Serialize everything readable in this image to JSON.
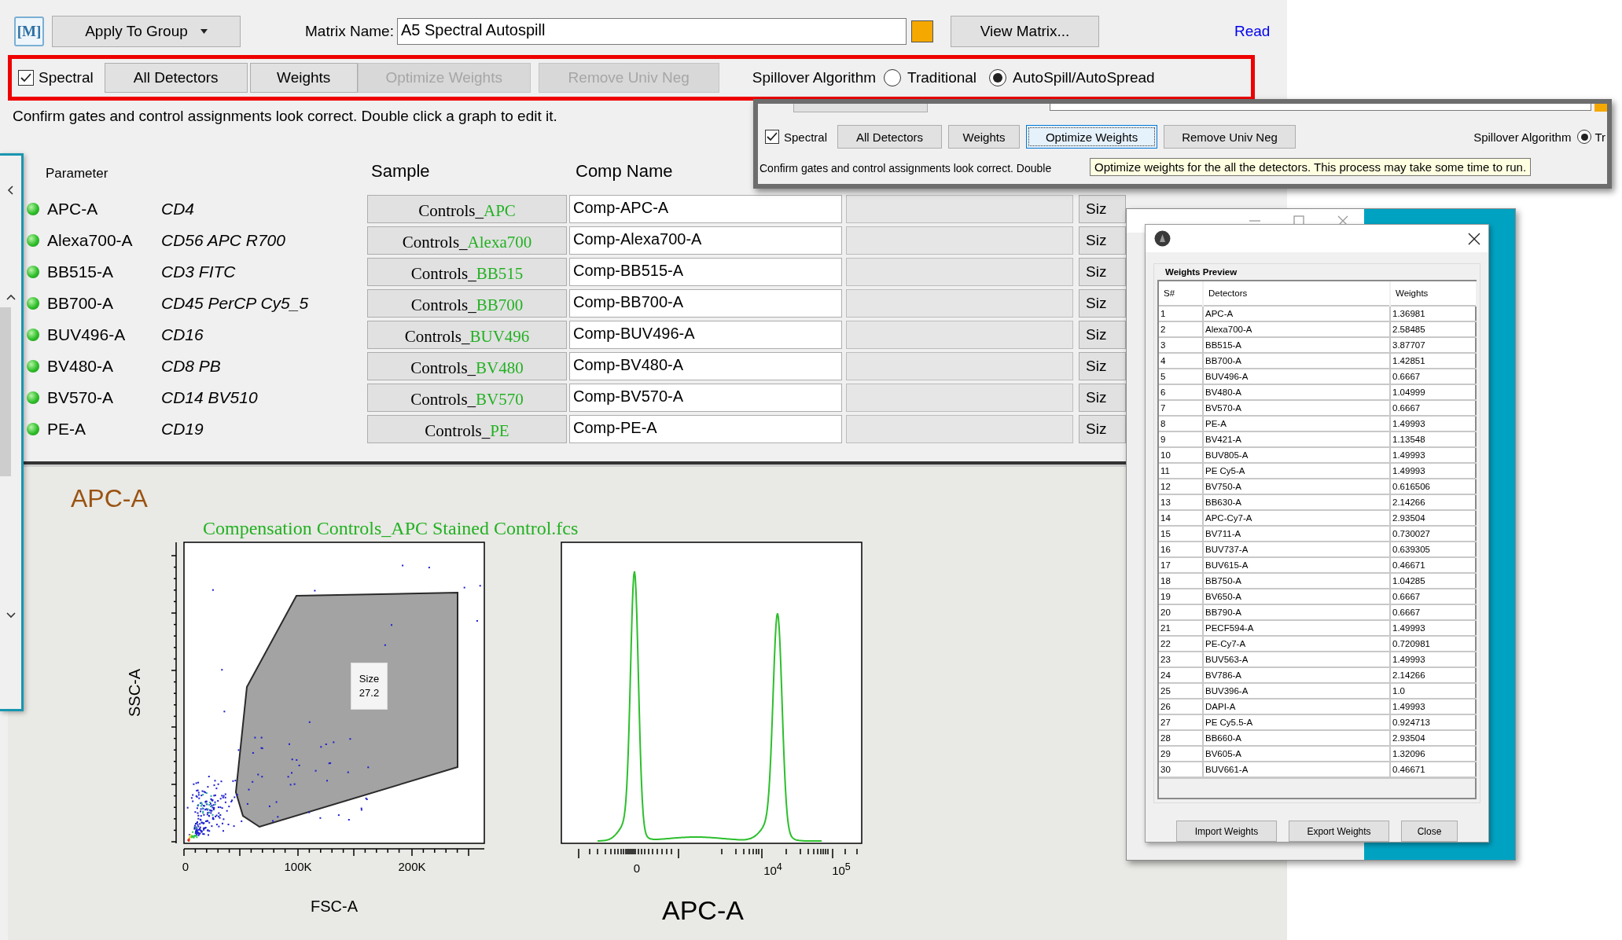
{
  "toolbar": {
    "logo": "[M]",
    "apply_button": "Apply To Group",
    "matrix_label": "Matrix Name:",
    "matrix_name": "A5 Spectral Autospill",
    "view_button": "View Matrix...",
    "status_link": "Read"
  },
  "options_bar": {
    "spectral": {
      "label": "Spectral",
      "checked": true
    },
    "buttons": [
      {
        "label": "All Detectors",
        "disabled": false
      },
      {
        "label": "Weights",
        "disabled": false
      },
      {
        "label": "Optimize Weights",
        "disabled": true
      },
      {
        "label": "Remove Univ Neg",
        "disabled": true
      }
    ],
    "algorithm_label": "Spillover Algorithm",
    "algorithms": [
      {
        "label": "Traditional",
        "selected": false
      },
      {
        "label": "AutoSpill/AutoSpread",
        "selected": true
      }
    ]
  },
  "message": "Confirm gates and control assignments look correct. Double click a graph to edit it.",
  "table": {
    "columns": [
      "Parameter",
      "Sample",
      "Comp Name"
    ],
    "rows": [
      {
        "parameter": "APC-A",
        "marker": "CD4",
        "sample_prefix": "Controls_",
        "sample_suffix": "APC",
        "comp_name": "Comp-APC-A",
        "size_button": "Siz"
      },
      {
        "parameter": "Alexa700-A",
        "marker": "CD56 APC R700",
        "sample_prefix": "Controls_",
        "sample_suffix": "Alexa700",
        "comp_name": "Comp-Alexa700-A",
        "size_button": "Siz"
      },
      {
        "parameter": "BB515-A",
        "marker": "CD3 FITC",
        "sample_prefix": "Controls_",
        "sample_suffix": "BB515",
        "comp_name": "Comp-BB515-A",
        "size_button": "Siz"
      },
      {
        "parameter": "BB700-A",
        "marker": "CD45 PerCP Cy5_5",
        "sample_prefix": "Controls_",
        "sample_suffix": "BB700",
        "comp_name": "Comp-BB700-A",
        "size_button": "Siz"
      },
      {
        "parameter": "BUV496-A",
        "marker": "CD16",
        "sample_prefix": "Controls_",
        "sample_suffix": "BUV496",
        "comp_name": "Comp-BUV496-A",
        "size_button": "Siz"
      },
      {
        "parameter": "BV480-A",
        "marker": "CD8 PB",
        "sample_prefix": "Controls_",
        "sample_suffix": "BV480",
        "comp_name": "Comp-BV480-A",
        "size_button": "Siz"
      },
      {
        "parameter": "BV570-A",
        "marker": "CD14 BV510",
        "sample_prefix": "Controls_",
        "sample_suffix": "BV570",
        "comp_name": "Comp-BV570-A",
        "size_button": "Siz"
      },
      {
        "parameter": "PE-A",
        "marker": "CD19",
        "sample_prefix": "Controls_",
        "sample_suffix": "PE",
        "comp_name": "Comp-PE-A",
        "size_button": "Siz"
      }
    ]
  },
  "plot": {
    "title": "APC-A",
    "file": "Compensation Controls_APC Stained Control.fcs",
    "scatter": {
      "xlabel": "FSC-A",
      "ylabel": "SSC-A",
      "xticks": [
        "0",
        "100K",
        "200K"
      ],
      "gate": {
        "name": "Size",
        "value": "27.2"
      }
    },
    "histogram": {
      "xlabel": "APC-A",
      "xticks": [
        "0",
        "10$^{4}$",
        "10$^{5}$"
      ]
    }
  },
  "overlay_window": {
    "spectral": {
      "label": "Spectral",
      "checked": true
    },
    "buttons": [
      {
        "label": "All Detectors",
        "focused": false
      },
      {
        "label": "Weights",
        "focused": false
      },
      {
        "label": "Optimize Weights",
        "focused": true
      },
      {
        "label": "Remove Univ Neg",
        "focused": false
      }
    ],
    "algorithm_label": "Spillover Algorithm",
    "algorithms": [
      {
        "label": "Tr",
        "selected": true
      }
    ],
    "message": "Confirm gates and control assignments look correct. Double",
    "tooltip": "Optimize weights for the all the detectors. This process may take some time to run."
  },
  "weights_dialog": {
    "group_title": "Weights Preview",
    "columns": [
      "S#",
      "Detectors",
      "Weights"
    ],
    "rows": [
      [
        "1",
        "APC-A",
        "1.36981"
      ],
      [
        "2",
        "Alexa700-A",
        "2.58485"
      ],
      [
        "3",
        "BB515-A",
        "3.87707"
      ],
      [
        "4",
        "BB700-A",
        "1.42851"
      ],
      [
        "5",
        "BUV496-A",
        "0.6667"
      ],
      [
        "6",
        "BV480-A",
        "1.04999"
      ],
      [
        "7",
        "BV570-A",
        "0.6667"
      ],
      [
        "8",
        "PE-A",
        "1.49993"
      ],
      [
        "9",
        "BV421-A",
        "1.13548"
      ],
      [
        "10",
        "BUV805-A",
        "1.49993"
      ],
      [
        "11",
        "PE Cy5-A",
        "1.49993"
      ],
      [
        "12",
        "BV750-A",
        "0.616506"
      ],
      [
        "13",
        "BB630-A",
        "2.14266"
      ],
      [
        "14",
        "APC-Cy7-A",
        "2.93504"
      ],
      [
        "15",
        "BV711-A",
        "0.730027"
      ],
      [
        "16",
        "BUV737-A",
        "0.639305"
      ],
      [
        "17",
        "BUV615-A",
        "0.46671"
      ],
      [
        "18",
        "BB750-A",
        "1.04285"
      ],
      [
        "19",
        "BV650-A",
        "0.6667"
      ],
      [
        "20",
        "BB790-A",
        "0.6667"
      ],
      [
        "21",
        "PECF594-A",
        "1.49993"
      ],
      [
        "22",
        "PE-Cy7-A",
        "0.720981"
      ],
      [
        "23",
        "BUV563-A",
        "1.49993"
      ],
      [
        "24",
        "BV786-A",
        "2.14266"
      ],
      [
        "25",
        "BUV396-A",
        "1.0"
      ],
      [
        "26",
        "DAPI-A",
        "1.49993"
      ],
      [
        "27",
        "PE Cy5.5-A",
        "0.924713"
      ],
      [
        "28",
        "BB660-A",
        "2.93504"
      ],
      [
        "29",
        "BV605-A",
        "1.32096"
      ],
      [
        "30",
        "BUV661-A",
        "0.46671"
      ]
    ],
    "buttons": [
      "Import Weights",
      "Export Weights",
      "Close"
    ]
  }
}
